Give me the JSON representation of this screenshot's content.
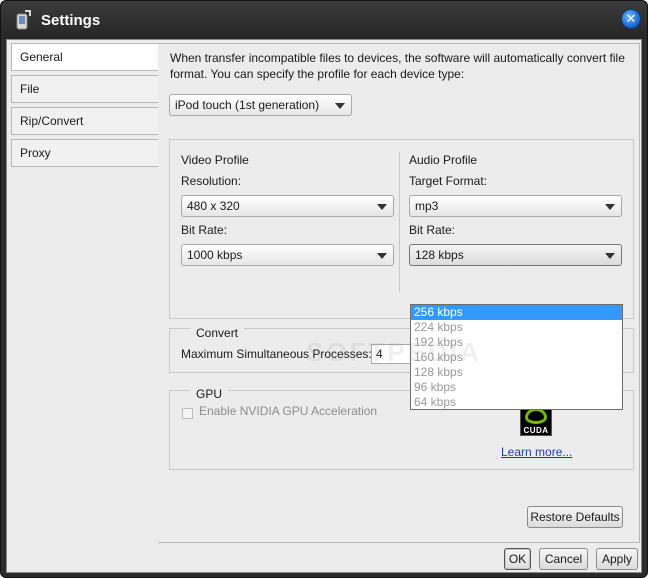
{
  "window": {
    "title": "Settings",
    "close_glyph": "✕"
  },
  "sidebar": {
    "items": [
      {
        "label": "General"
      },
      {
        "label": "File"
      },
      {
        "label": "Rip/Convert"
      },
      {
        "label": "Proxy"
      }
    ]
  },
  "main": {
    "intro": "When transfer incompatible files to devices, the software will automatically convert file format. You can specify the profile for each device type:",
    "device_select": {
      "value": "iPod touch (1st generation)"
    },
    "video": {
      "heading": "Video Profile",
      "resolution_label": "Resolution:",
      "resolution_value": "480 x 320",
      "bitrate_label": "Bit Rate:",
      "bitrate_value": "1000 kbps"
    },
    "audio": {
      "heading": "Audio Profile",
      "format_label": "Target Format:",
      "format_value": "mp3",
      "bitrate_label": "Bit Rate:",
      "bitrate_value": "128 kbps",
      "bitrate_options": [
        "256 kbps",
        "224 kbps",
        "192 kbps",
        "160 kbps",
        "128 kbps",
        "96 kbps",
        "64 kbps"
      ]
    },
    "convert": {
      "legend": "Convert",
      "max_label": "Maximum Simultaneous Processes:",
      "max_value": "4"
    },
    "gpu": {
      "legend": "GPU",
      "checkbox_label": "Enable NVIDIA GPU Acceleration",
      "checked": false,
      "logo_text": "CUDA",
      "link": "Learn more..."
    },
    "restore_label": "Restore Defaults"
  },
  "footer": {
    "ok_label": "OK",
    "cancel_label": "Cancel",
    "apply_label": "Apply"
  },
  "watermark": "SOFTPEDIA",
  "colors": {
    "title_bar": "#2b2b2b",
    "selection": "#3399ff",
    "link": "#1a3fb0",
    "nvidia_green": "#76b900"
  }
}
